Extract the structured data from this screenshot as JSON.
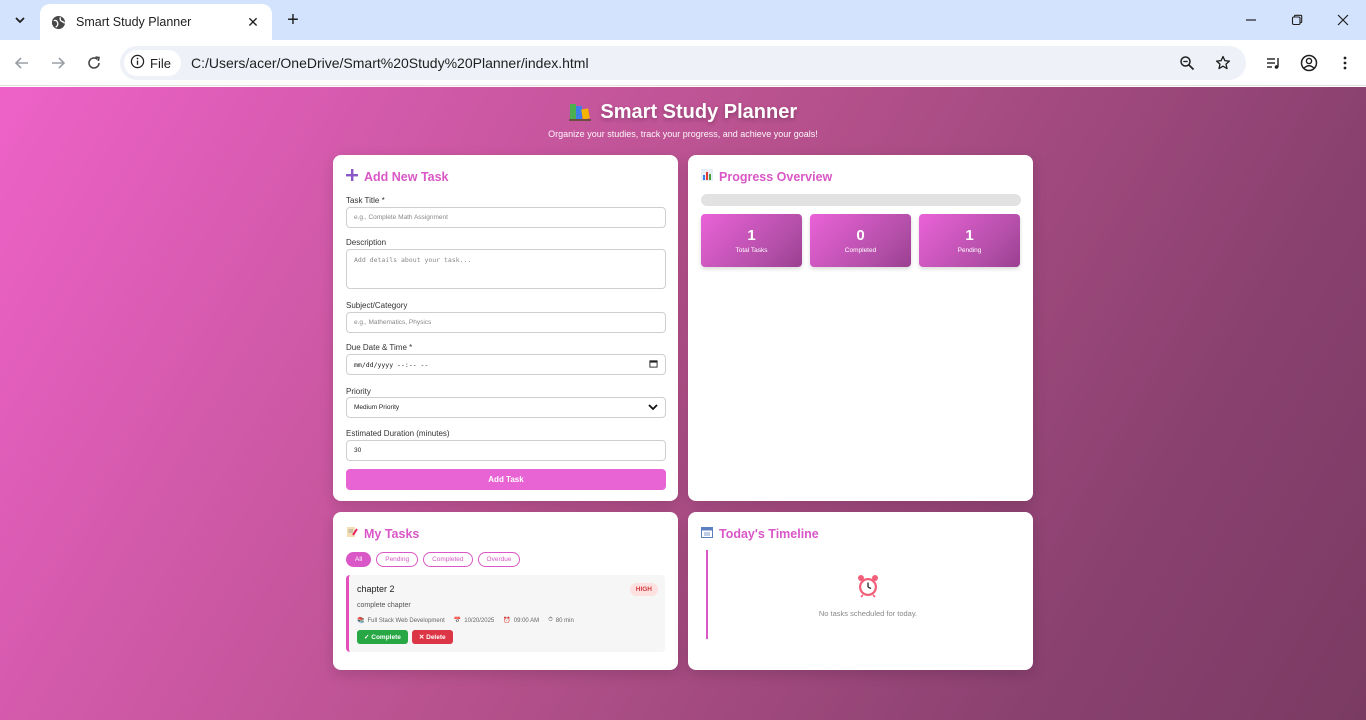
{
  "browser": {
    "tab_title": "Smart Study Planner",
    "file_chip": "File",
    "url": "C:/Users/acer/OneDrive/Smart%20Study%20Planner/index.html"
  },
  "header": {
    "icon": "books-icon",
    "title": "Smart Study Planner",
    "subtitle": "Organize your studies, track your progress, and achieve your goals!"
  },
  "add_task": {
    "title": "Add New Task",
    "task_title_label": "Task Title *",
    "task_title_placeholder": "e.g., Complete Math Assignment",
    "description_label": "Description",
    "description_placeholder": "Add details about your task...",
    "subject_label": "Subject/Category",
    "subject_placeholder": "e.g., Mathematics, Physics",
    "due_label": "Due Date & Time *",
    "due_value": "mm/dd/yyyy --:-- --",
    "priority_label": "Priority",
    "priority_value": "Medium Priority",
    "duration_label": "Estimated Duration (minutes)",
    "duration_value": "30",
    "button": "Add Task"
  },
  "progress": {
    "title": "Progress Overview",
    "completion_percent": 0,
    "stats": [
      {
        "value": "1",
        "label": "Total Tasks"
      },
      {
        "value": "0",
        "label": "Completed"
      },
      {
        "value": "1",
        "label": "Pending"
      }
    ]
  },
  "tasks": {
    "title": "My Tasks",
    "filters": [
      "All",
      "Pending",
      "Completed",
      "Overdue"
    ],
    "active_filter": "All",
    "items": [
      {
        "title": "chapter 2",
        "priority": "HIGH",
        "description": "complete chapter",
        "subject": "Full Stack Web Development",
        "date": "10/20/2025",
        "time": "09:00 AM",
        "duration": "80 min",
        "complete_label": "✓ Complete",
        "delete_label": "✕ Delete"
      }
    ]
  },
  "timeline": {
    "title": "Today's Timeline",
    "empty_text": "No tasks scheduled for today."
  },
  "colors": {
    "accent": "#d957c6",
    "button": "#e863d4",
    "complete": "#28a745",
    "delete": "#dc3545",
    "high_badge_bg": "#fde1e1",
    "high_badge_text": "#d63c3c"
  }
}
